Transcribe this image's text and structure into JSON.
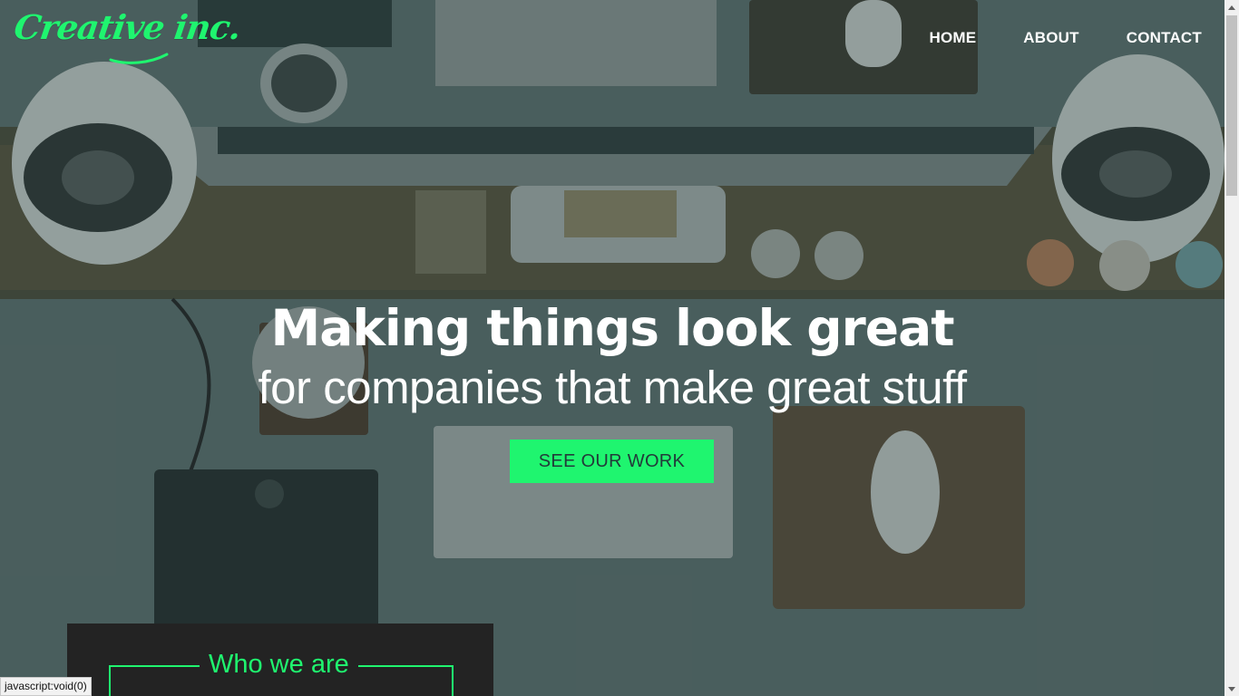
{
  "brand": {
    "logo_text": "Creative inc.",
    "accent_color": "#1ff56f"
  },
  "nav": {
    "items": [
      {
        "label": "HOME"
      },
      {
        "label": "ABOUT"
      },
      {
        "label": "CONTACT"
      }
    ]
  },
  "hero": {
    "headline": "Making things look great",
    "subheadline": "for companies that make great stuff",
    "cta_label": "SEE OUR WORK"
  },
  "about_section": {
    "title": "Who we are"
  },
  "browser": {
    "status_text": "javascript:void(0)"
  }
}
